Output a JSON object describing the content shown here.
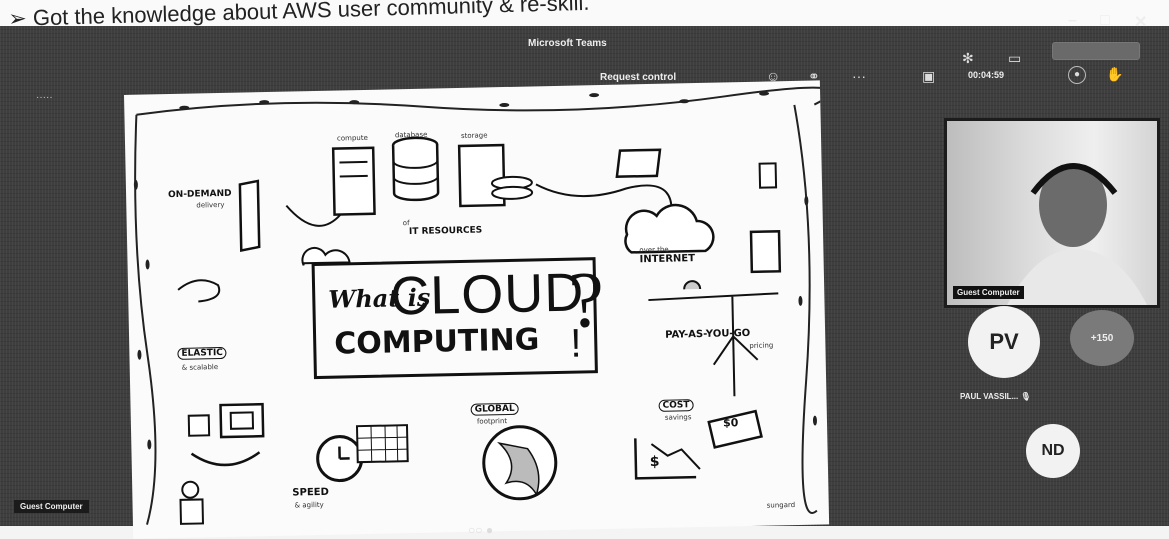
{
  "caption": {
    "text": "➢ Got the knowledge about AWS user community & re-skill."
  },
  "window": {
    "title": "Microsoft Teams",
    "controls": {
      "minimize": "–",
      "maximize": "□",
      "close": "✕"
    },
    "request_control": "Request control",
    "timer": "00:04:59",
    "menu_dots": "·····",
    "toolbar_icons": [
      "people-icon",
      "chat-icon",
      "more-icon",
      "camera-icon",
      "mic-icon",
      "share-icon",
      "leave-icon"
    ]
  },
  "slide": {
    "title_what": "What is",
    "title_cloud": "CLOUD",
    "title_computing": "COMPUTING",
    "question": "?",
    "exclaim": "!",
    "labels": {
      "on_demand": "ON-DEMAND",
      "on_demand_sub": "delivery",
      "compute": "compute",
      "database": "database",
      "storage": "storage",
      "it_resources": "IT RESOURCES",
      "it_prefix": "of",
      "internet": "INTERNET",
      "internet_prefix": "over the",
      "elastic": "ELASTIC",
      "elastic_sub": "& scalable",
      "pay": "PAY-AS-YOU-GO",
      "pay_sub": "pricing",
      "global": "GLOBAL",
      "global_sub": "footprint",
      "cost": "COST",
      "cost_sub": "savings",
      "cost_sign": "$0",
      "cost_graph": "$",
      "speed": "SPEED",
      "speed_sub": "& agility",
      "credit": "sungard"
    }
  },
  "video": {
    "participant_label": "Guest Computer"
  },
  "participants": {
    "pv": {
      "initials": "PV",
      "name": "PAUL VASSIL... 🎙"
    },
    "extra": {
      "count": "+150"
    },
    "nd": {
      "initials": "ND"
    }
  },
  "footer": {
    "guest": "Guest Computer",
    "page_dots": "○○ ●"
  }
}
